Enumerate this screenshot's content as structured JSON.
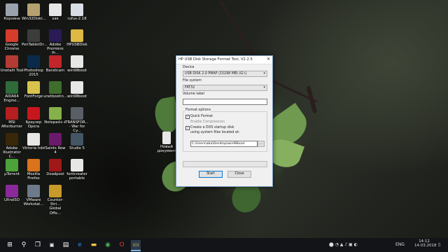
{
  "desktop_icons": [
    {
      "label": "Корзина",
      "color": "#9aa3ad",
      "glyph": "recycle-bin"
    },
    {
      "label": "Win32DiskI...",
      "color": "#b6a070",
      "glyph": "disk-imager"
    },
    {
      "label": "хак",
      "color": "#e7e7e7",
      "glyph": "file"
    },
    {
      "label": "rufus-2.18",
      "color": "#d9dee6",
      "glyph": "usb"
    },
    {
      "label": "Google\nChrome",
      "color": "#d63c2c",
      "glyph": "chrome"
    },
    {
      "label": "PenTabletDr...",
      "color": "#3c3c3c",
      "glyph": "tablet"
    },
    {
      "label": "Adobe\nPremiere Pr...",
      "color": "#2a1a55",
      "glyph": "Pr"
    },
    {
      "label": "HPUSBDisk",
      "color": "#e0b844",
      "glyph": "usb-format"
    },
    {
      "label": "Unetalit Tool",
      "color": "#b33b34",
      "glyph": "tool"
    },
    {
      "label": "Photoshop\n2015",
      "color": "#0b2a4a",
      "glyph": "Ps"
    },
    {
      "label": "Bandicam",
      "color": "#c2262a",
      "glyph": "bandicam"
    },
    {
      "label": "win98boot",
      "color": "#e7e7e7",
      "glyph": "file"
    },
    {
      "label": "AIDA64\nEngine...",
      "color": "#2f6a3a",
      "glyph": "aida"
    },
    {
      "label": "FontForge",
      "color": "#d9c24c",
      "glyph": "ff"
    },
    {
      "label": "unetbootin...",
      "color": "#3f6d2e",
      "glyph": "unetbootin"
    },
    {
      "label": "win98boot",
      "color": "#e7e7e7",
      "glyph": "file"
    },
    {
      "label": "MSI\nAfterburner",
      "color": "#b51f1f",
      "glyph": "msi"
    },
    {
      "label": "Браузер\nOpera",
      "color": "#c8161d",
      "glyph": "opera"
    },
    {
      "label": "Notepad++",
      "color": "#86b04a",
      "glyph": "notepad"
    },
    {
      "label": "TRANSFOR...\n- War for Cy...",
      "color": "#5a5f66",
      "glyph": "game"
    },
    {
      "label": "Adobe\nIllustrator C...",
      "color": "#3a2608",
      "glyph": "Ai"
    },
    {
      "label": "Victoria hdd",
      "color": "#e7e7e7",
      "glyph": "file"
    },
    {
      "label": "Saints Row 4",
      "color": "#6a1a6a",
      "glyph": "game"
    },
    {
      "label": "Studio 5",
      "color": "#445566",
      "glyph": "studio"
    },
    {
      "label": "µTorrent",
      "color": "#4da23a",
      "glyph": "utorrent"
    },
    {
      "label": "Mozilla\nFirefox",
      "color": "#d9741c",
      "glyph": "firefox"
    },
    {
      "label": "Deadpool",
      "color": "#a01818",
      "glyph": "game"
    },
    {
      "label": "fontcreator\nportable",
      "color": "#e7e7e7",
      "glyph": "file"
    },
    {
      "label": "UltraISO",
      "color": "#8a2a9a",
      "glyph": "ultraiso"
    },
    {
      "label": "VMware\nWorkstat...",
      "color": "#6c7a89",
      "glyph": "vmware"
    },
    {
      "label": "Counter-Stri...\nGlobal Offe...",
      "color": "#c79a2a",
      "glyph": "game"
    }
  ],
  "doc_icon": {
    "label": "Новый\nдокумент",
    "color": "#e7e7e7"
  },
  "window": {
    "title": "HP USB Disk Storage Format Tool, V2.2.5",
    "close_glyph": "✕",
    "device_label": "Device",
    "device_value": "USB DISK 2.0     PMAP (15298 MB) (G:\\)",
    "fs_label": "File system",
    "fs_value": "FAT32",
    "volume_label": "Volume label",
    "volume_value": "",
    "options_label": "Format options",
    "quick_format": "Quick Format",
    "quick_format_checked": true,
    "enable_compression": "Enable Compression",
    "create_dos": "Create a DOS startup disk",
    "create_dos_checked": true,
    "using_files": "using system files located at:",
    "path_value": "C:\\Users\\aba\\Desktop\\win98boot",
    "browse_label": "...",
    "start_label": "Start",
    "close_label": "Close",
    "progress": 0
  },
  "taskbar": {
    "time": "14:12",
    "date": "14.03.2018",
    "lang": "ENG"
  },
  "colors": {
    "accent": "#0078d7",
    "taskbar": "#121417",
    "leaf": "#7aa35a"
  }
}
